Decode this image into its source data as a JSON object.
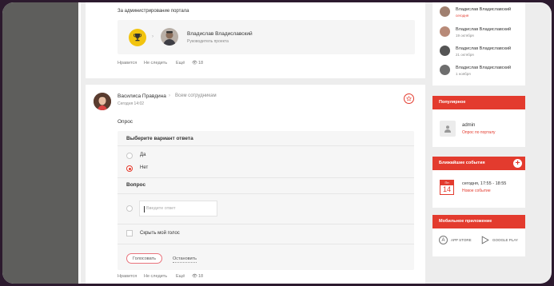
{
  "post1": {
    "caption": "За администрирование портала",
    "award_user": {
      "name": "Владислав Владиславский",
      "role": "Руководитель проекта"
    },
    "actions": {
      "like": "Нравится",
      "unfollow": "Не следить",
      "more": "Ещё",
      "views": "18"
    }
  },
  "post2": {
    "author": "Василиса Правдина",
    "audience": "Всем сотрудникам",
    "time": "Сегодня 14:02",
    "title": "Опрос",
    "question_header": "Выберите вариант ответа",
    "options": [
      "Да",
      "Нет"
    ],
    "selected_option": "Нет",
    "question_label": "Вопрос",
    "answer_placeholder": "Введите ответ",
    "hide_vote_label": "Скрыть мой голос",
    "vote_button": "Голосовать",
    "stop_link": "Остановить",
    "actions": {
      "like": "Нравится",
      "unfollow": "Не следить",
      "more": "Ещё",
      "views": "18"
    }
  },
  "birthdays": [
    {
      "name": "Владислав Владиславский",
      "date": "сегодня",
      "date_color": "#e33b2e"
    },
    {
      "name": "Владислав Владиславский",
      "date": "19 октября"
    },
    {
      "name": "Владислав Владиславский",
      "date": "21 октября"
    },
    {
      "name": "Владислав Владиславский",
      "date": "1 ноября"
    }
  ],
  "popular": {
    "title": "Популярное",
    "user_name": "admin",
    "link": "Опрос по порталу"
  },
  "events": {
    "title": "Ближайшие события",
    "cal_day_label": "Пн",
    "cal_day": "14",
    "time": "сегодня, 17:55 - 18:55",
    "link": "Новое событие"
  },
  "mobile": {
    "title": "Мобильное приложение",
    "app_store": "APP STORE",
    "google_play": "GOOGLE PLAY"
  },
  "colors": {
    "accent": "#e33b2e",
    "trophy": "#f2c40f"
  }
}
